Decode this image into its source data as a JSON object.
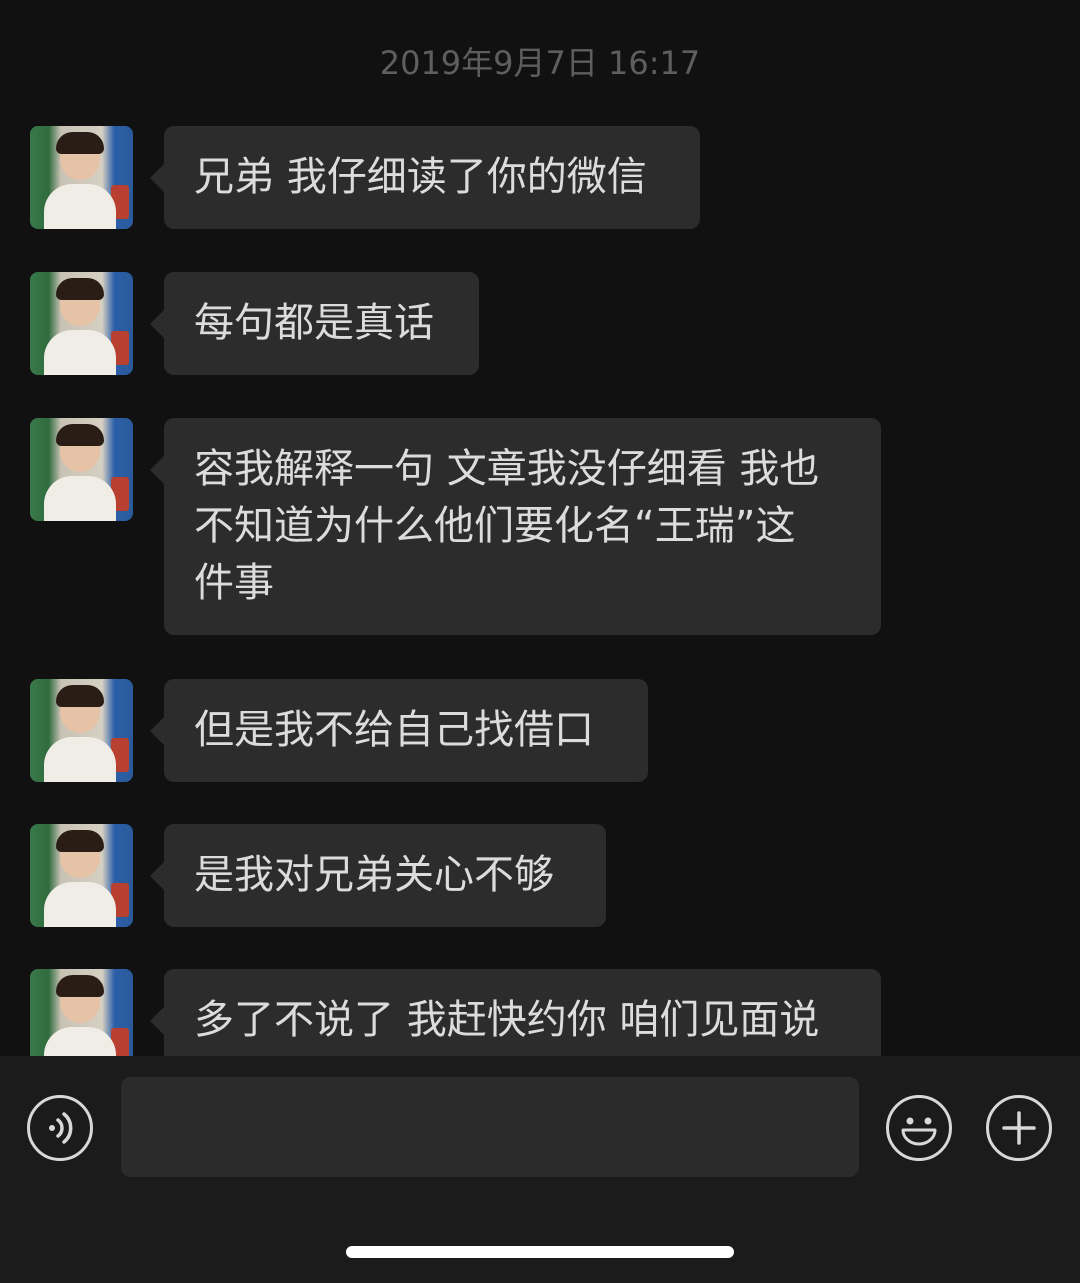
{
  "chat": {
    "timestamp": "2019年9月7日 16:17",
    "messages": [
      {
        "text": "兄弟 我仔细读了你的微信"
      },
      {
        "text": "每句都是真话"
      },
      {
        "text": "容我解释一句 文章我没仔细看 我也\n不知道为什么他们要化名“王瑞”这\n件事"
      },
      {
        "text": "但是我不给自己找借口"
      },
      {
        "text": "是我对兄弟关心不够"
      },
      {
        "text": "多了不说了 我赶快约你 咱们见面说"
      }
    ]
  },
  "input_bar": {
    "voice_icon": "voice-icon",
    "emoji_icon": "emoji-icon",
    "plus_icon": "plus-icon",
    "message_value": ""
  }
}
